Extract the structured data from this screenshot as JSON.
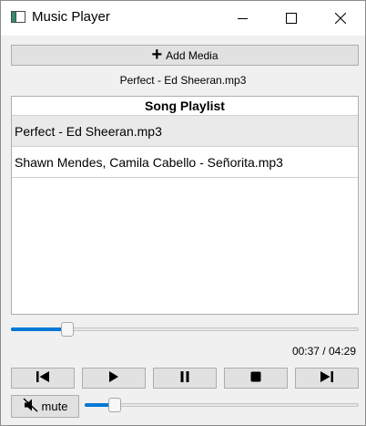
{
  "window": {
    "title": "Music Player",
    "icon": "app-window-icon",
    "controls": [
      "minimize-icon",
      "maximize-icon",
      "close-icon"
    ]
  },
  "toolbar": {
    "add_media_label": "Add Media",
    "add_media_icon": "plus-icon"
  },
  "now_playing": "Perfect - Ed Sheeran.mp3",
  "playlist": {
    "header": "Song Playlist",
    "items": [
      {
        "label": "Perfect - Ed Sheeran.mp3",
        "selected": true
      },
      {
        "label": "Shawn Mendes, Camila Cabello - Señorita.mp3",
        "selected": false
      }
    ]
  },
  "playback": {
    "position": "00:37",
    "duration": "04:29",
    "time_text": "00:37 / 04:29",
    "progress_fraction": 0.15
  },
  "controls": {
    "previous_icon": "skip-previous-icon",
    "play_icon": "play-icon",
    "pause_icon": "pause-icon",
    "stop_icon": "stop-icon",
    "next_icon": "skip-next-icon"
  },
  "volume": {
    "mute_label": "mute",
    "mute_icon": "speaker-muted-icon",
    "level_fraction": 0.09
  },
  "colors": {
    "accent": "#0078d7"
  }
}
